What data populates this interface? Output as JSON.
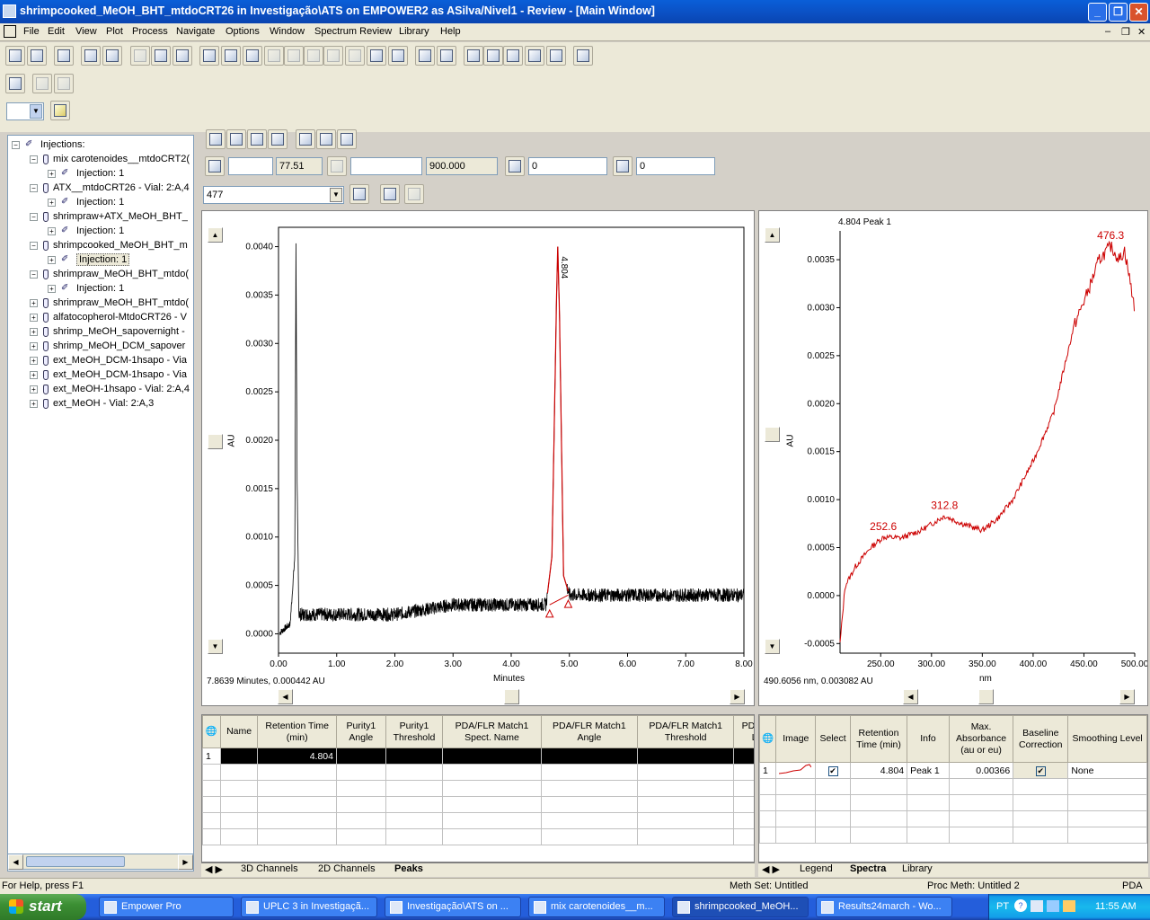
{
  "window": {
    "title": "shrimpcooked_MeOH_BHT_mtdoCRT26 in Investigação\\ATS on EMPOWER2 as ASilva/Nivel1 - Review - [Main Window]"
  },
  "menu": [
    "File",
    "Edit",
    "View",
    "Plot",
    "Process",
    "Navigate",
    "Options",
    "Window",
    "Spectrum Review",
    "Library",
    "Help"
  ],
  "tree": {
    "root": "Injections:",
    "nodes": [
      {
        "label": "mix carotenoides__mtdoCRT2(",
        "type": "vial",
        "expanded": true
      },
      {
        "label": "Injection: 1",
        "type": "inj"
      },
      {
        "label": "ATX__mtdoCRT26 - Vial: 2:A,4",
        "type": "vial",
        "expanded": true
      },
      {
        "label": "Injection: 1",
        "type": "inj"
      },
      {
        "label": "shrimpraw+ATX_MeOH_BHT_",
        "type": "vial",
        "expanded": true
      },
      {
        "label": "Injection: 1",
        "type": "inj"
      },
      {
        "label": "shrimpcooked_MeOH_BHT_m",
        "type": "vial",
        "expanded": true
      },
      {
        "label": "Injection: 1",
        "type": "inj",
        "selected": true
      },
      {
        "label": "shrimpraw_MeOH_BHT_mtdo(",
        "type": "vial",
        "expanded": true
      },
      {
        "label": "Injection: 1",
        "type": "inj"
      },
      {
        "label": "shrimpraw_MeOH_BHT_mtdo(",
        "type": "vial"
      },
      {
        "label": "alfatocopherol-MtdoCRT26 - V",
        "type": "vial"
      },
      {
        "label": "shrimp_MeOH_sapovernight - ",
        "type": "vial"
      },
      {
        "label": "shrimp_MeOH_DCM_sapover",
        "type": "vial"
      },
      {
        "label": "ext_MeOH_DCM-1hsapo - Via",
        "type": "vial"
      },
      {
        "label": "ext_MeOH_DCM-1hsapo - Via",
        "type": "vial"
      },
      {
        "label": "ext_MeOH-1hsapo - Vial: 2:A,4",
        "type": "vial"
      },
      {
        "label": "ext_MeOH - Vial: 2:A,3",
        "type": "vial"
      }
    ]
  },
  "fields": {
    "f1": "",
    "f1val": "77.51",
    "f2": "",
    "f2val": "900.000",
    "f3": "0",
    "f4": "0",
    "wavelength": "477"
  },
  "chromatogram": {
    "xlabel": "Minutes",
    "ylabel": "AU",
    "peak_label": "4.804",
    "cursor": "7.8639 Minutes, 0.000442 AU",
    "yticks": [
      "0.0040",
      "0.0035",
      "0.0030",
      "0.0025",
      "0.0020",
      "0.0015",
      "0.0010",
      "0.0005",
      "0.0000"
    ],
    "xticks": [
      "0.00",
      "1.00",
      "2.00",
      "3.00",
      "4.00",
      "5.00",
      "6.00",
      "7.00",
      "8.00"
    ]
  },
  "chart_data": [
    {
      "type": "line",
      "xlabel": "Minutes",
      "ylabel": "AU",
      "xlim": [
        0,
        8
      ],
      "ylim": [
        -0.0002,
        0.0042
      ],
      "series": [
        {
          "x": [
            0.0,
            0.2,
            0.28,
            0.3,
            0.32,
            0.35,
            0.4,
            1.0,
            2.0,
            3.0,
            4.0,
            4.6,
            4.7,
            4.78,
            4.8,
            4.83,
            4.9,
            5.0,
            6.0,
            7.0,
            8.0
          ],
          "y": [
            0.0,
            0.0001,
            0.0008,
            0.004,
            0.0015,
            0.0002,
            0.0002,
            0.0002,
            0.0002,
            0.0003,
            0.0003,
            0.0003,
            0.0008,
            0.0035,
            0.004,
            0.0033,
            0.0006,
            0.0004,
            0.0004,
            0.0004,
            0.0004
          ]
        }
      ],
      "annotations": [
        "4.804"
      ]
    },
    {
      "type": "line",
      "title": "4.804 Peak 1",
      "xlabel": "nm",
      "ylabel": "AU",
      "xlim": [
        210,
        500
      ],
      "ylim": [
        -0.0006,
        0.0038
      ],
      "series": [
        {
          "x": [
            210,
            215,
            225,
            240,
            252.6,
            270,
            290,
            312.8,
            330,
            350,
            365,
            380,
            400,
            420,
            440,
            455,
            465,
            476.3,
            485,
            490,
            500
          ],
          "y": [
            -0.0005,
            0.0001,
            0.0003,
            0.0005,
            0.00061,
            0.0006,
            0.00068,
            0.00083,
            0.00075,
            0.00068,
            0.0008,
            0.001,
            0.0014,
            0.0019,
            0.0028,
            0.0032,
            0.0035,
            0.00364,
            0.0035,
            0.0036,
            0.003
          ]
        }
      ],
      "annotations": [
        "252.6",
        "312.8",
        "476.3"
      ]
    }
  ],
  "spectrum": {
    "title": "4.804 Peak 1",
    "xlabel": "nm",
    "ylabel": "AU",
    "cursor": "490.6056 nm, 0.003082 AU",
    "yticks": [
      "0.0035",
      "0.0030",
      "0.0025",
      "0.0020",
      "0.0015",
      "0.0010",
      "0.0005",
      "0.0000",
      "-0.0005"
    ],
    "xticks": [
      "250.00",
      "300.00",
      "350.00",
      "400.00",
      "450.00",
      "500.00"
    ],
    "labels": [
      "252.6",
      "312.8",
      "476.3"
    ]
  },
  "peaks_table": {
    "headers": [
      "Name",
      "Retention Time (min)",
      "Purity1 Angle",
      "Purity1 Threshold",
      "PDA/FLR Match1 Spect. Name",
      "PDA/FLR Match1 Angle",
      "PDA/FLR Match1 Threshold",
      "PDA/FLR Matc Lib. Name"
    ],
    "row_num": "1",
    "rt": "4.804",
    "tabs": [
      "3D Channels",
      "2D Channels",
      "Peaks"
    ]
  },
  "spectra_table": {
    "headers": [
      "Image",
      "Select",
      "Retention Time (min)",
      "Info",
      "Max. Absorbance (au or eu)",
      "Baseline Correction",
      "Smoothing Level"
    ],
    "row": {
      "num": "1",
      "rt": "4.804",
      "info": "Peak 1",
      "maxabs": "0.00366",
      "smoothing": "None"
    },
    "tabs": [
      "Legend",
      "Spectra",
      "Library"
    ]
  },
  "status": {
    "help": "For Help, press F1",
    "methset": "Meth Set: Untitled",
    "procmeth": "Proc Meth: Untitled 2",
    "mode": "PDA"
  },
  "taskbar": {
    "start": "start",
    "tasks": [
      "Empower Pro",
      "UPLC 3 in Investigaçã...",
      "Investigação\\ATS on ...",
      "mix carotenoides__m...",
      "shrimpcooked_MeOH...",
      "Results24march - Wo..."
    ],
    "lang": "PT",
    "clock": "11:55 AM"
  }
}
